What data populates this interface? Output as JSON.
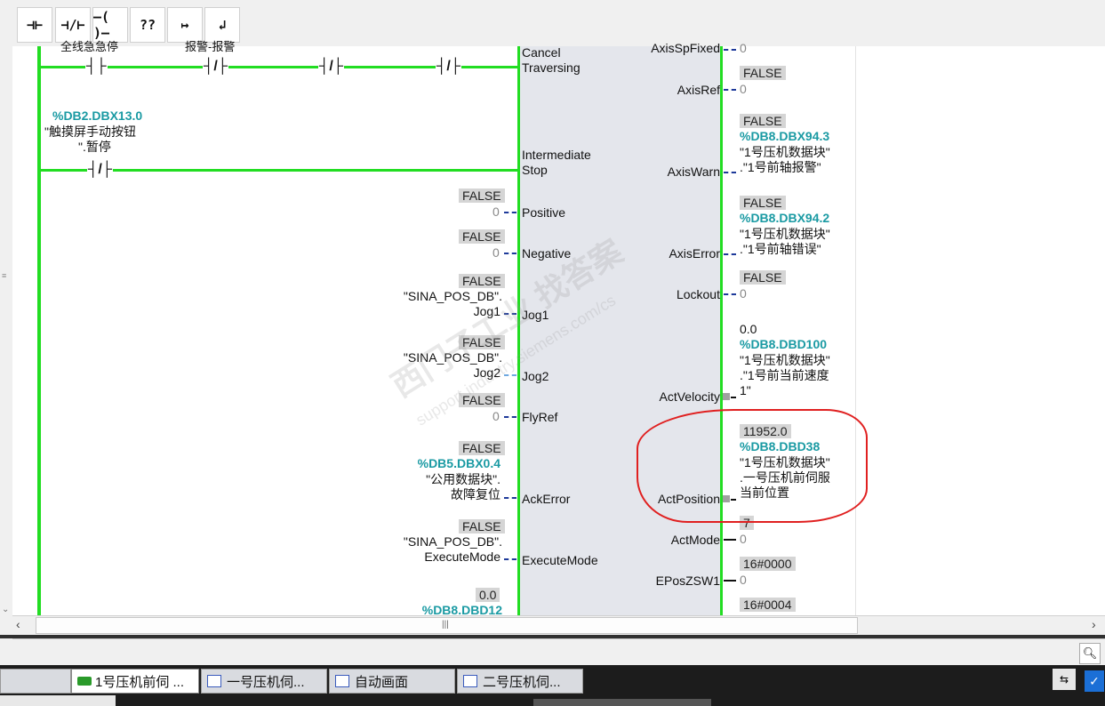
{
  "toolbar": {
    "buttons": [
      {
        "label": "⊣⊢",
        "icon": "no-contact-icon"
      },
      {
        "label": "⊣/⊢",
        "icon": "nc-contact-icon"
      },
      {
        "label": "–( )–",
        "icon": "coil-icon"
      },
      {
        "label": "??",
        "icon": "empty-box-icon"
      },
      {
        "label": "↦",
        "icon": "open-branch-icon"
      },
      {
        "label": "↲",
        "icon": "close-branch-icon"
      }
    ]
  },
  "ladder": {
    "top_labels": [
      "全线急急停",
      "报警-报警"
    ],
    "contact2": {
      "address": "%DB2.DBX13.0",
      "symbol_line1": "\"触摸屏手动按钮",
      "symbol_line2": "\".暂停"
    }
  },
  "fb_inputs": [
    {
      "pin": "Cancel",
      "pin2": "Traversing"
    },
    {
      "pin": "Intermediate",
      "pin2": "Stop"
    },
    {
      "pin": "Positive",
      "value": "FALSE",
      "const": "0"
    },
    {
      "pin": "Negative",
      "value": "FALSE",
      "const": "0"
    },
    {
      "pin": "Jog1",
      "value": "FALSE",
      "sym1": "\"SINA_POS_DB\".",
      "sym2": "Jog1"
    },
    {
      "pin": "Jog2",
      "value": "FALSE",
      "sym1": "\"SINA_POS_DB\".",
      "sym2": "Jog2"
    },
    {
      "pin": "FlyRef",
      "value": "FALSE",
      "const": "0"
    },
    {
      "pin": "AckError",
      "value": "FALSE",
      "address": "%DB5.DBX0.4",
      "sym1": "\"公用数据块\".",
      "sym2": "故障复位"
    },
    {
      "pin": "ExecuteMode",
      "value": "FALSE",
      "sym1": "\"SINA_POS_DB\".",
      "sym2": "ExecuteMode"
    },
    {
      "value": "0.0",
      "address": "%DB8.DBD12"
    }
  ],
  "fb_outputs": [
    {
      "pin": "AxisSpFixed",
      "const": "0"
    },
    {
      "pin": "AxisRef",
      "value": "FALSE",
      "const": "0"
    },
    {
      "pin": "AxisWarn",
      "value": "FALSE",
      "address": "%DB8.DBX94.3",
      "sym1": "\"1号压机数据块\"",
      "sym2": ".\"1号前轴报警\""
    },
    {
      "pin": "AxisError",
      "value": "FALSE",
      "address": "%DB8.DBX94.2",
      "sym1": "\"1号压机数据块\"",
      "sym2": ".\"1号前轴错误\""
    },
    {
      "pin": "Lockout",
      "value": "FALSE",
      "const": "0"
    },
    {
      "pin": "ActVelocity",
      "value": "0.0",
      "address": "%DB8.DBD100",
      "sym1": "\"1号压机数据块\"",
      "sym2": ".\"1号前当前速度",
      "sym3": "1\""
    },
    {
      "pin": "ActPosition",
      "value": "11952.0",
      "address": "%DB8.DBD38",
      "sym1": "\"1号压机数据块\"",
      "sym2": ".一号压机前伺服",
      "sym3": "当前位置"
    },
    {
      "pin": "ActMode",
      "value": "7",
      "const": "0"
    },
    {
      "pin": "EPosZSW1",
      "value": "16#0000",
      "const": "0"
    },
    {
      "value": "16#0004"
    }
  ],
  "watermark": {
    "line1": "西门子工业 找答案",
    "line2": "support.industry.siemens.com/cs"
  },
  "taskbar": {
    "items": [
      {
        "label": "",
        "icon": "window-icon"
      },
      {
        "label": "1号压机前伺 ...",
        "icon": "ladder-block-icon"
      },
      {
        "label": "一号压机伺...",
        "icon": "window-icon"
      },
      {
        "label": "自动画面",
        "icon": "window-icon"
      },
      {
        "label": "二号压机伺...",
        "icon": "window-icon"
      }
    ]
  },
  "colors": {
    "rail": "#22dd22",
    "address": "#1a9aa3",
    "fb_bg": "#e4e6ec",
    "highlight": "#e02020"
  }
}
